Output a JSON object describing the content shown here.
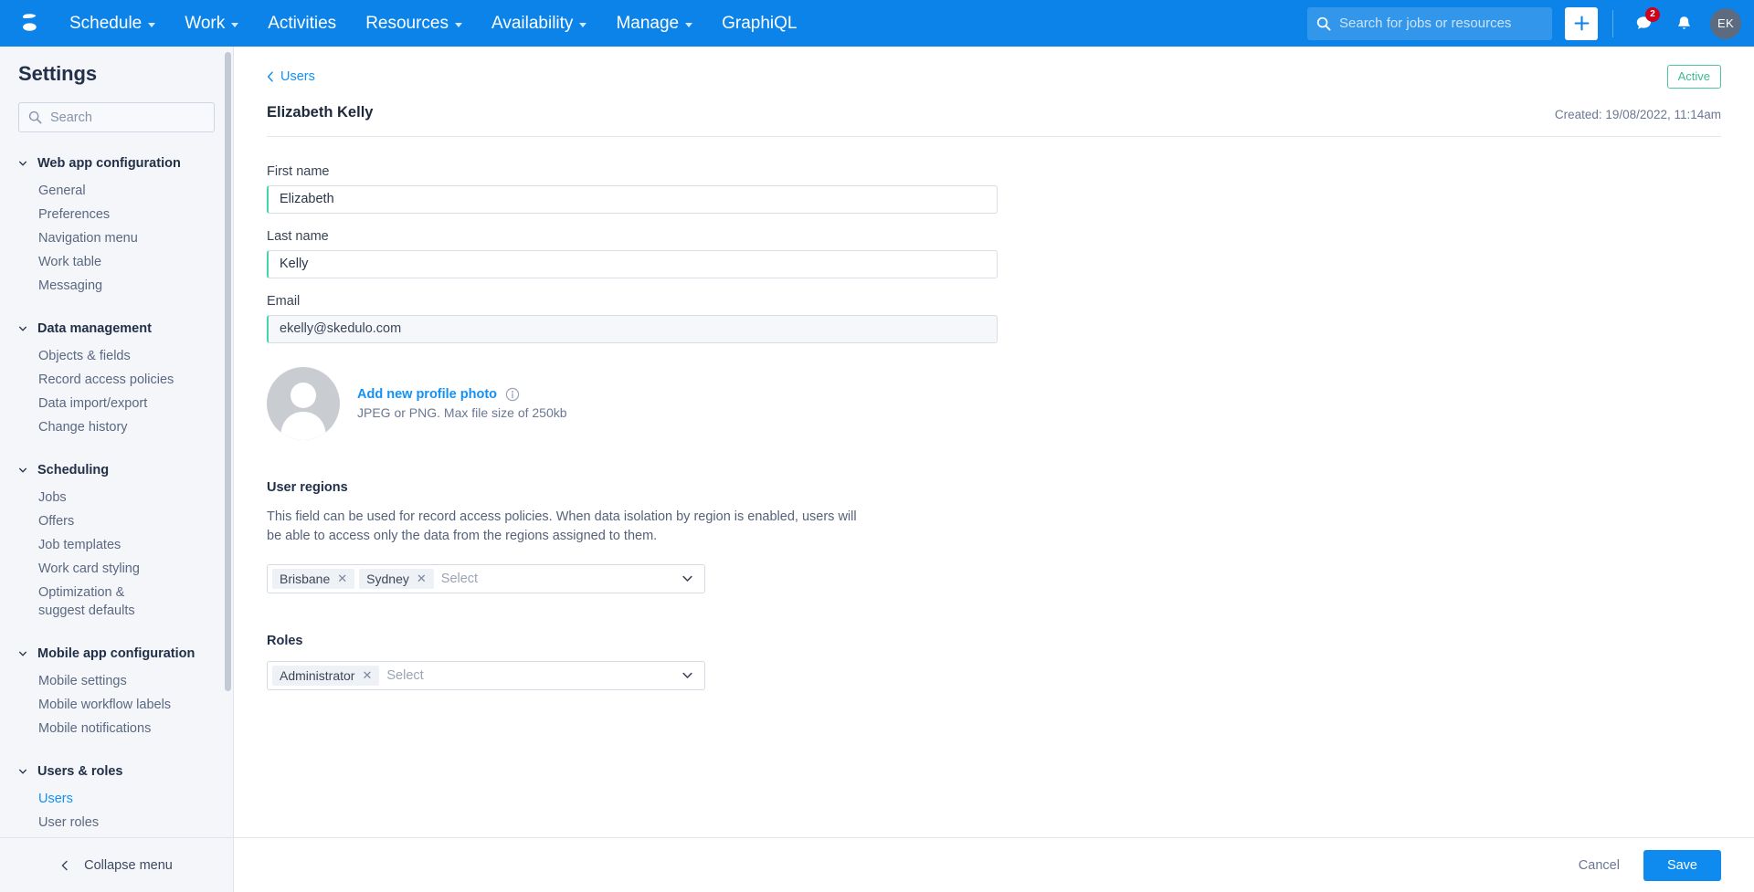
{
  "topnav": {
    "logo_icon": "skedulo-logo-icon",
    "items": [
      {
        "label": "Schedule",
        "has_caret": true
      },
      {
        "label": "Work",
        "has_caret": true
      },
      {
        "label": "Activities",
        "has_caret": false
      },
      {
        "label": "Resources",
        "has_caret": true
      },
      {
        "label": "Availability",
        "has_caret": true
      },
      {
        "label": "Manage",
        "has_caret": true
      },
      {
        "label": "GraphiQL",
        "has_caret": false
      }
    ],
    "search_placeholder": "Search for jobs or resources",
    "add_button_label": "+",
    "messages_badge": "2",
    "avatar_initials": "EK",
    "brand_color": "#0b83e8",
    "badge_color": "#d0021b"
  },
  "sidebar": {
    "title": "Settings",
    "search_placeholder": "Search",
    "collapse_label": "Collapse menu",
    "groups": [
      {
        "label": "Web app configuration",
        "expanded": true,
        "items": [
          {
            "label": "General",
            "active": false
          },
          {
            "label": "Preferences",
            "active": false
          },
          {
            "label": "Navigation menu",
            "active": false
          },
          {
            "label": "Work table",
            "active": false
          },
          {
            "label": "Messaging",
            "active": false
          }
        ]
      },
      {
        "label": "Data management",
        "expanded": true,
        "items": [
          {
            "label": "Objects & fields",
            "active": false
          },
          {
            "label": "Record access policies",
            "active": false
          },
          {
            "label": "Data import/export",
            "active": false
          },
          {
            "label": "Change history",
            "active": false
          }
        ]
      },
      {
        "label": "Scheduling",
        "expanded": true,
        "items": [
          {
            "label": "Jobs",
            "active": false
          },
          {
            "label": "Offers",
            "active": false
          },
          {
            "label": "Job templates",
            "active": false
          },
          {
            "label": "Work card styling",
            "active": false
          },
          {
            "label": "Optimization & suggest defaults",
            "active": false
          }
        ]
      },
      {
        "label": "Mobile app configuration",
        "expanded": true,
        "items": [
          {
            "label": "Mobile settings",
            "active": false
          },
          {
            "label": "Mobile workflow labels",
            "active": false
          },
          {
            "label": "Mobile notifications",
            "active": false
          }
        ]
      },
      {
        "label": "Users & roles",
        "expanded": true,
        "items": [
          {
            "label": "Users",
            "active": true
          },
          {
            "label": "User roles",
            "active": false
          }
        ]
      }
    ]
  },
  "main": {
    "breadcrumb_label": "Users",
    "record_title": "Elizabeth Kelly",
    "status_badge": "Active",
    "status_color": "#3fb994",
    "created_text": "Created: 19/08/2022, 11:14am",
    "fields": [
      {
        "label": "First name",
        "value": "Elizabeth",
        "readonly": false
      },
      {
        "label": "Last name",
        "value": "Kelly",
        "readonly": false
      },
      {
        "label": "Email",
        "value": "ekelly@skedulo.com",
        "readonly": true
      }
    ],
    "photo": {
      "add_link": "Add new profile photo",
      "info_icon": "info-circle-icon",
      "hint": "JPEG or PNG. Max file size of 250kb"
    },
    "user_regions": {
      "title": "User regions",
      "description": "This field can be used for record access policies. When data isolation by region is enabled, users will be able to access only the data from the regions assigned to them.",
      "chips": [
        "Brisbane",
        "Sydney"
      ],
      "placeholder": "Select"
    },
    "roles": {
      "title": "Roles",
      "chips": [
        "Administrator"
      ],
      "placeholder": "Select"
    }
  },
  "footer": {
    "cancel_label": "Cancel",
    "save_label": "Save",
    "save_color": "#0f8bf0"
  }
}
